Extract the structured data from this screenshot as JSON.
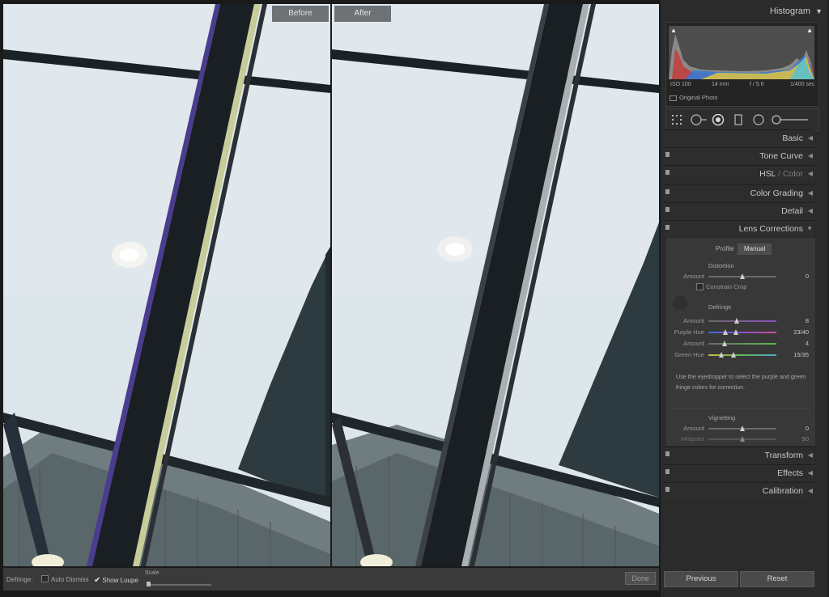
{
  "compare": {
    "before_label": "Before",
    "after_label": "After"
  },
  "toolbar": {
    "defringe_label": "Defringe:",
    "auto_dismiss_label": "Auto Dismiss",
    "auto_dismiss_checked": false,
    "show_loupe_label": "Show Loupe",
    "show_loupe_checked": true,
    "scale_label": "Scale",
    "done_label": "Done"
  },
  "histogram": {
    "title": "Histogram",
    "iso": "ISO 100",
    "focal": "14 mm",
    "aperture": "f / 5.6",
    "shutter": "1/400 sec",
    "original_photo_label": "Original Photo"
  },
  "sections": {
    "basic": "Basic",
    "tone_curve": "Tone Curve",
    "hsl": "HSL",
    "hsl_sep": " / ",
    "color": "Color",
    "color_grading": "Color Grading",
    "detail": "Detail",
    "lens_corrections": "Lens Corrections",
    "transform": "Transform",
    "effects": "Effects",
    "calibration": "Calibration"
  },
  "lens": {
    "tab_profile": "Profile",
    "tab_manual": "Manual",
    "distortion_title": "Distortion",
    "distortion_amount_label": "Amount",
    "distortion_amount_value": "0",
    "constrain_crop_label": "Constrain Crop",
    "defringe_title": "Defringe",
    "purple_amount_label": "Amount",
    "purple_amount_value": "8",
    "purple_hue_label": "Purple Hue",
    "purple_hue_value": "23/40",
    "green_amount_label": "Amount",
    "green_amount_value": "4",
    "green_hue_label": "Green Hue",
    "green_hue_value": "15/35",
    "note": "Use the eyedropper to select the purple and green fringe colors for correction.",
    "vignetting_title": "Vignetting",
    "vignetting_amount_label": "Amount",
    "vignetting_amount_value": "0",
    "midpoint_label": "Midpoint",
    "midpoint_value": "50"
  },
  "buttons": {
    "previous": "Previous",
    "reset": "Reset"
  }
}
